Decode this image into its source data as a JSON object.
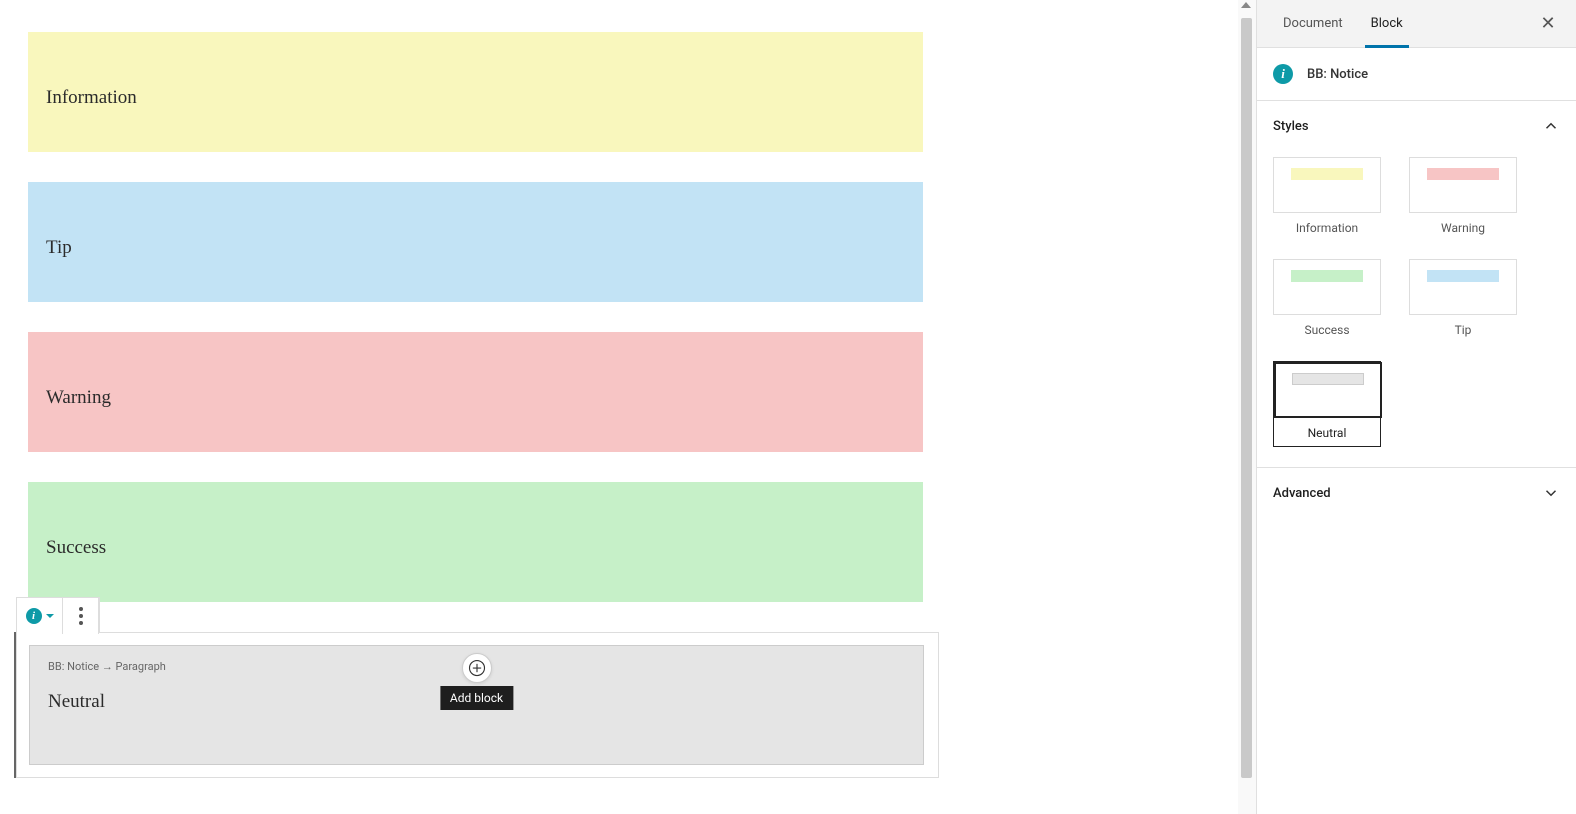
{
  "editor": {
    "notices": [
      {
        "label": "Information",
        "style": "information"
      },
      {
        "label": "Tip",
        "style": "tip"
      },
      {
        "label": "Warning",
        "style": "warning"
      },
      {
        "label": "Success",
        "style": "success"
      }
    ],
    "selected_notice": {
      "breadcrumb": "BB: Notice  →  Paragraph",
      "label": "Neutral",
      "style": "neutral"
    },
    "add_block_tooltip": "Add block"
  },
  "sidebar": {
    "tabs": {
      "document": "Document",
      "block": "Block",
      "active": "block"
    },
    "block_title": "BB: Notice",
    "panels": {
      "styles": {
        "title": "Styles",
        "options": [
          {
            "label": "Information",
            "swatch": "information"
          },
          {
            "label": "Warning",
            "swatch": "warning"
          },
          {
            "label": "Success",
            "swatch": "success"
          },
          {
            "label": "Tip",
            "swatch": "tip"
          },
          {
            "label": "Neutral",
            "swatch": "neutral",
            "selected": true
          }
        ]
      },
      "advanced": {
        "title": "Advanced"
      }
    }
  }
}
